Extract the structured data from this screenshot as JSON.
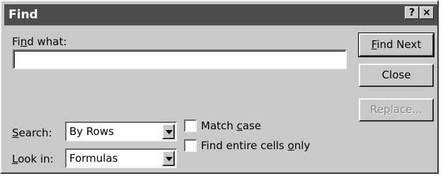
{
  "dialog": {
    "title": "Find",
    "help_glyph": "?",
    "close_glyph": "×"
  },
  "find_what": {
    "label_accel": "n",
    "label_pre": "Fi",
    "label_post": "d what:",
    "value": ""
  },
  "buttons": {
    "find_next_accel": "F",
    "find_next_rest": "ind Next",
    "close": "Close",
    "replace_accel": "p",
    "replace_pre": "Re",
    "replace_post": "lace..."
  },
  "search": {
    "label_accel": "S",
    "label_rest": "earch:",
    "value": "By Rows"
  },
  "look_in": {
    "label_accel": "L",
    "label_rest": "ook in:",
    "value": "Formulas"
  },
  "options": {
    "match_case_accel": "c",
    "match_case_pre": "Match ",
    "match_case_post": "ase",
    "match_case_checked": false,
    "entire_cells_accel": "o",
    "entire_cells_pre": "Find entire cells ",
    "entire_cells_post": "nly",
    "entire_cells_checked": false
  }
}
